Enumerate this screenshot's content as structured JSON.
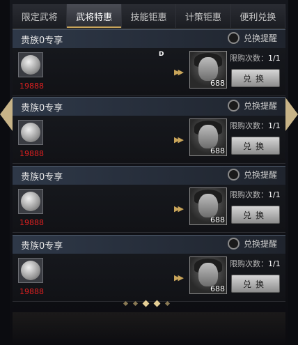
{
  "tabs": [
    {
      "label": "限定武将",
      "active": false
    },
    {
      "label": "武将特惠",
      "active": true
    },
    {
      "label": "技能钜惠",
      "active": false
    },
    {
      "label": "计策钜惠",
      "active": false
    },
    {
      "label": "便利兑换",
      "active": false
    }
  ],
  "cards": [
    {
      "title": "贵族0专享",
      "remind_label": "兑换提醒",
      "price": "19888",
      "mark": "D",
      "hero_num": "688",
      "limit_label": "限购次数：",
      "limit_count": "1/1",
      "button_label": "兑换"
    },
    {
      "title": "贵族0专享",
      "remind_label": "兑换提醒",
      "price": "19888",
      "mark": "",
      "hero_num": "688",
      "limit_label": "限购次数：",
      "limit_count": "1/1",
      "button_label": "兑换"
    },
    {
      "title": "贵族0专享",
      "remind_label": "兑换提醒",
      "price": "19888",
      "mark": "",
      "hero_num": "688",
      "limit_label": "限购次数：",
      "limit_count": "1/1",
      "button_label": "兑换"
    },
    {
      "title": "贵族0专享",
      "remind_label": "兑换提醒",
      "price": "19888",
      "mark": "",
      "hero_num": "688",
      "limit_label": "限购次数：",
      "limit_count": "1/1",
      "button_label": "兑换"
    }
  ],
  "pagination": {
    "pages": 5,
    "current": 2
  },
  "colors": {
    "accent": "#c9a55a",
    "price": "#e02020",
    "arrow": "#c8b488"
  },
  "icons": {
    "prev": "left-arrow-icon",
    "next": "right-arrow-icon",
    "coin": "silver-coin-icon",
    "step": "double-chevron-icon"
  }
}
